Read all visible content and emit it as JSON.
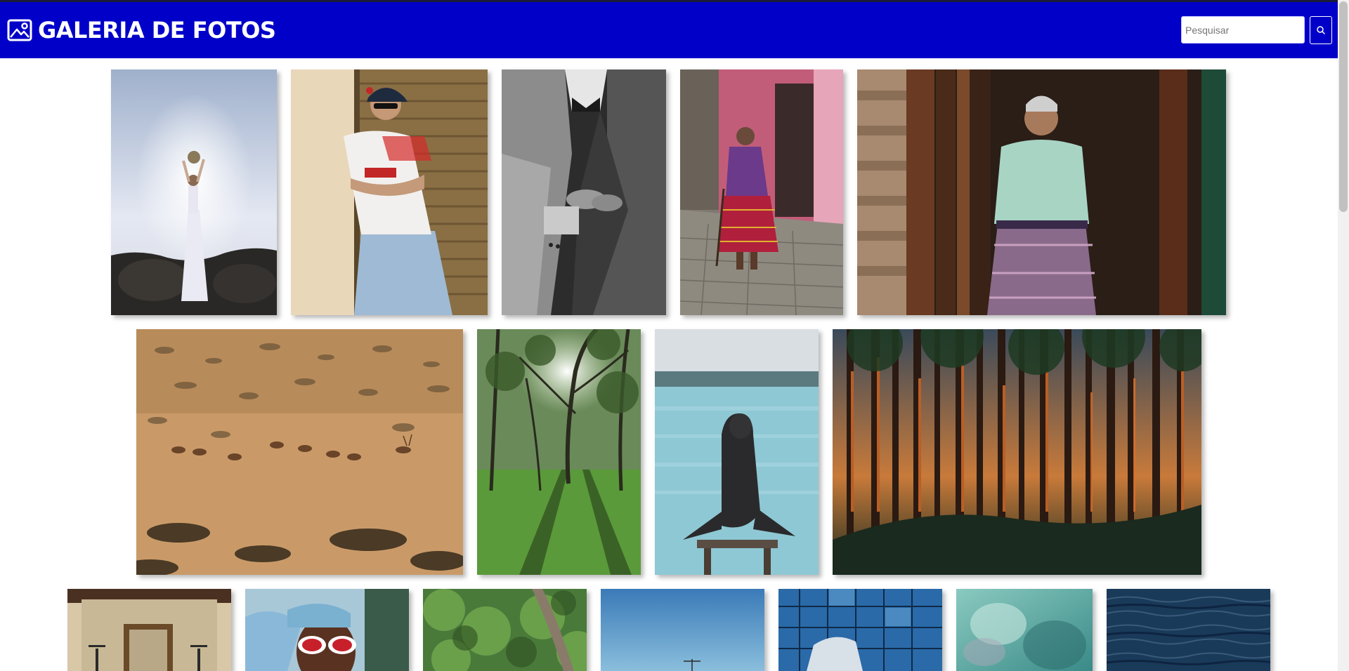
{
  "header": {
    "title": "GALERIA DE FOTOS",
    "logo_icon": "image-icon",
    "background": "#0000c8"
  },
  "search": {
    "placeholder": "Pesquisar",
    "value": "",
    "button_icon": "search-icon"
  },
  "gallery": {
    "photos": [
      "bride-holding-bouquet",
      "man-in-cap-and-jersey",
      "suit-black-and-white",
      "woman-walking-street",
      "elderly-woman-portrait",
      "deer-in-field",
      "sunlit-forest-clearing",
      "sea-lion",
      "pine-forest-sunset",
      "framed-picture-room",
      "woman-red-sunglasses",
      "green-trees",
      "blue-sky-antenna",
      "glass-building",
      "teal-abstract",
      "ocean-waves"
    ]
  }
}
